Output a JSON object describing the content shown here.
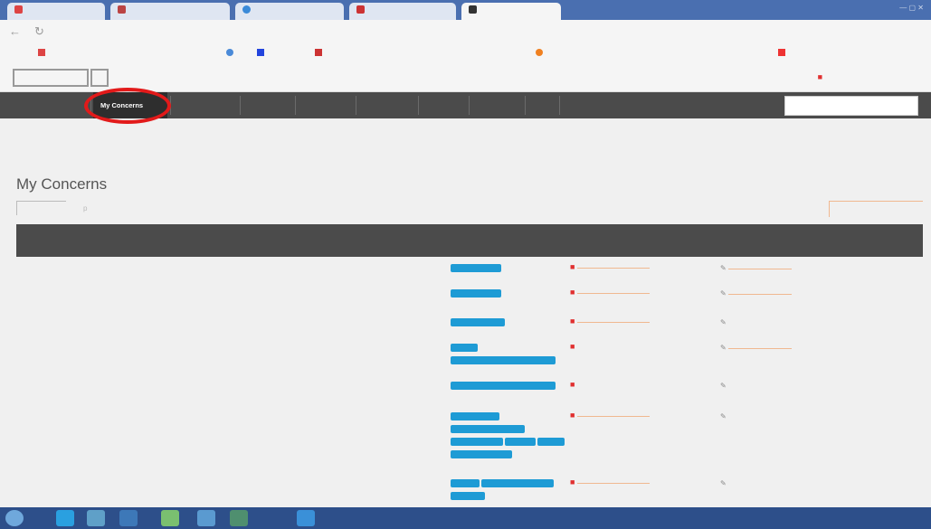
{
  "page": {
    "title": "My Concerns",
    "filter_label": "p"
  },
  "nav": {
    "items": [
      "My Concerns"
    ]
  },
  "browser": {
    "toolbar_icons": [
      "back-arrow-icon",
      "reload-icon"
    ]
  },
  "colors": {
    "nav_bg": "#4b4b4b",
    "accent_tag": "#1e9bd5",
    "link_peach": "#f0a070",
    "person_red": "#e03030",
    "highlight_ring": "#e21a1a",
    "taskbar": "#2d4f8a"
  },
  "icons": {
    "person": "person-icon",
    "pencil": "pencil-icon"
  }
}
